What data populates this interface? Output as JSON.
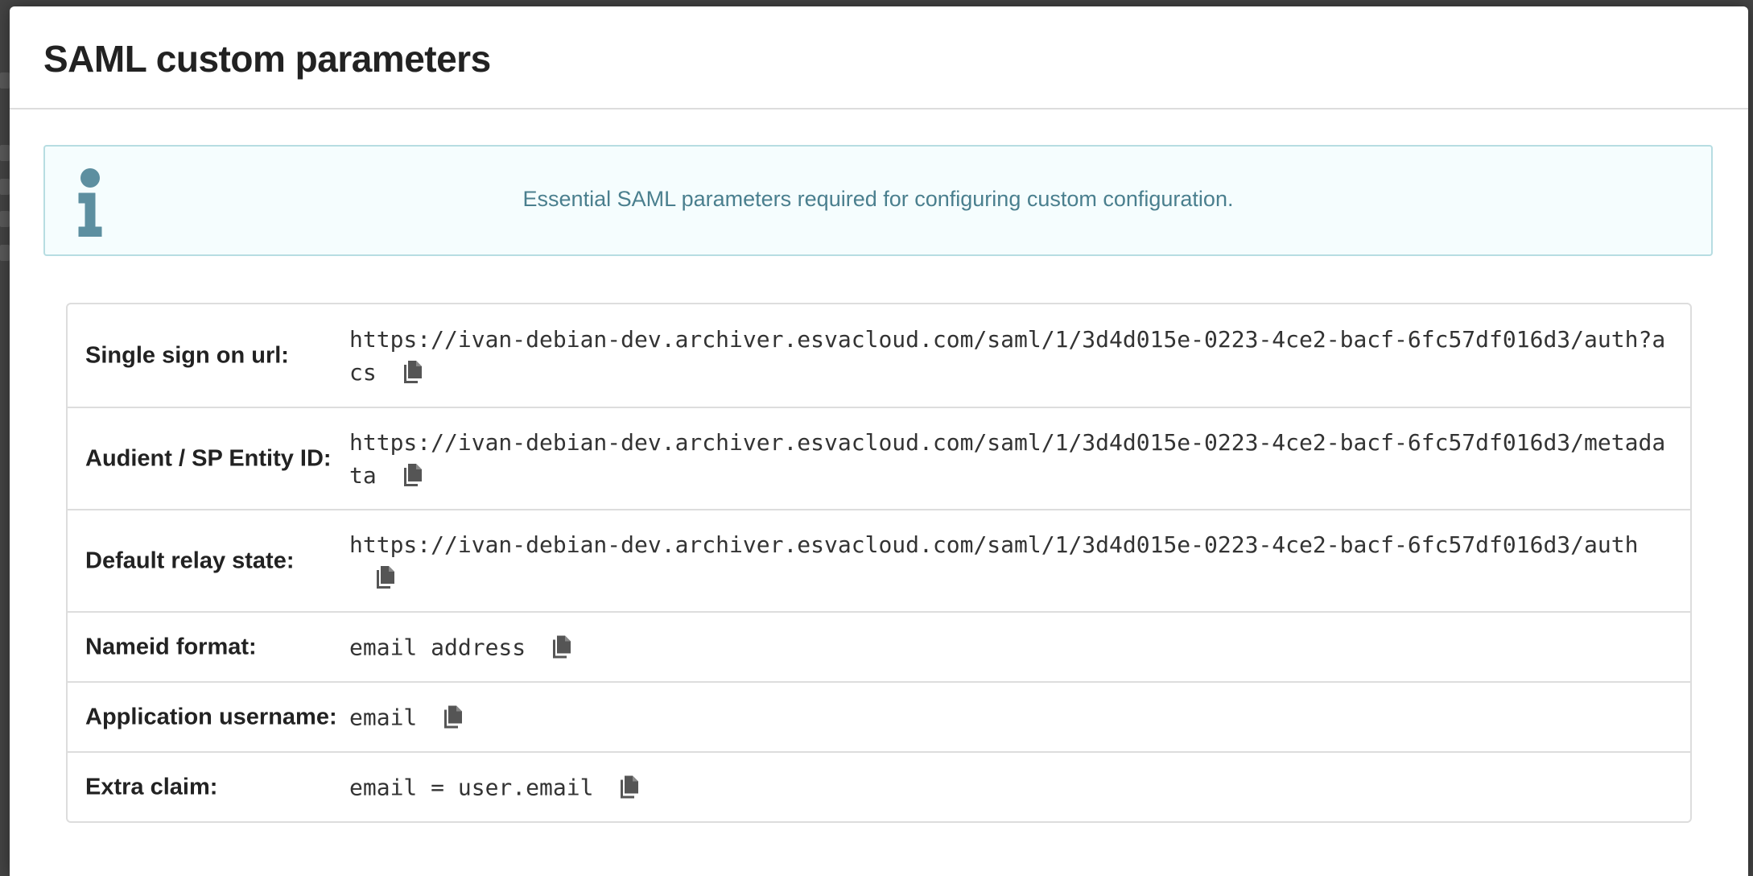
{
  "modal": {
    "title": "SAML custom parameters"
  },
  "alert": {
    "icon": "info-icon",
    "text": "Essential SAML parameters required for configuring custom configuration.",
    "color": "#4a7f8e"
  },
  "params": [
    {
      "label": "Single sign on url:",
      "value": "https://ivan-debian-dev.archiver.esvacloud.com/saml/1/3d4d015e-0223-4ce2-bacf-6fc57df016d3/auth?acs",
      "copy_icon": "copy-icon"
    },
    {
      "label": "Audient / SP Entity ID:",
      "value": "https://ivan-debian-dev.archiver.esvacloud.com/saml/1/3d4d015e-0223-4ce2-bacf-6fc57df016d3/metadata",
      "copy_icon": "copy-icon"
    },
    {
      "label": "Default relay state:",
      "value": "https://ivan-debian-dev.archiver.esvacloud.com/saml/1/3d4d015e-0223-4ce2-bacf-6fc57df016d3/auth",
      "copy_icon": "copy-icon"
    },
    {
      "label": "Nameid format:",
      "value": "email address",
      "copy_icon": "copy-icon"
    },
    {
      "label": "Application username:",
      "value": "email",
      "copy_icon": "copy-icon"
    },
    {
      "label": "Extra claim:",
      "value": "email = user.email",
      "copy_icon": "copy-icon"
    }
  ]
}
